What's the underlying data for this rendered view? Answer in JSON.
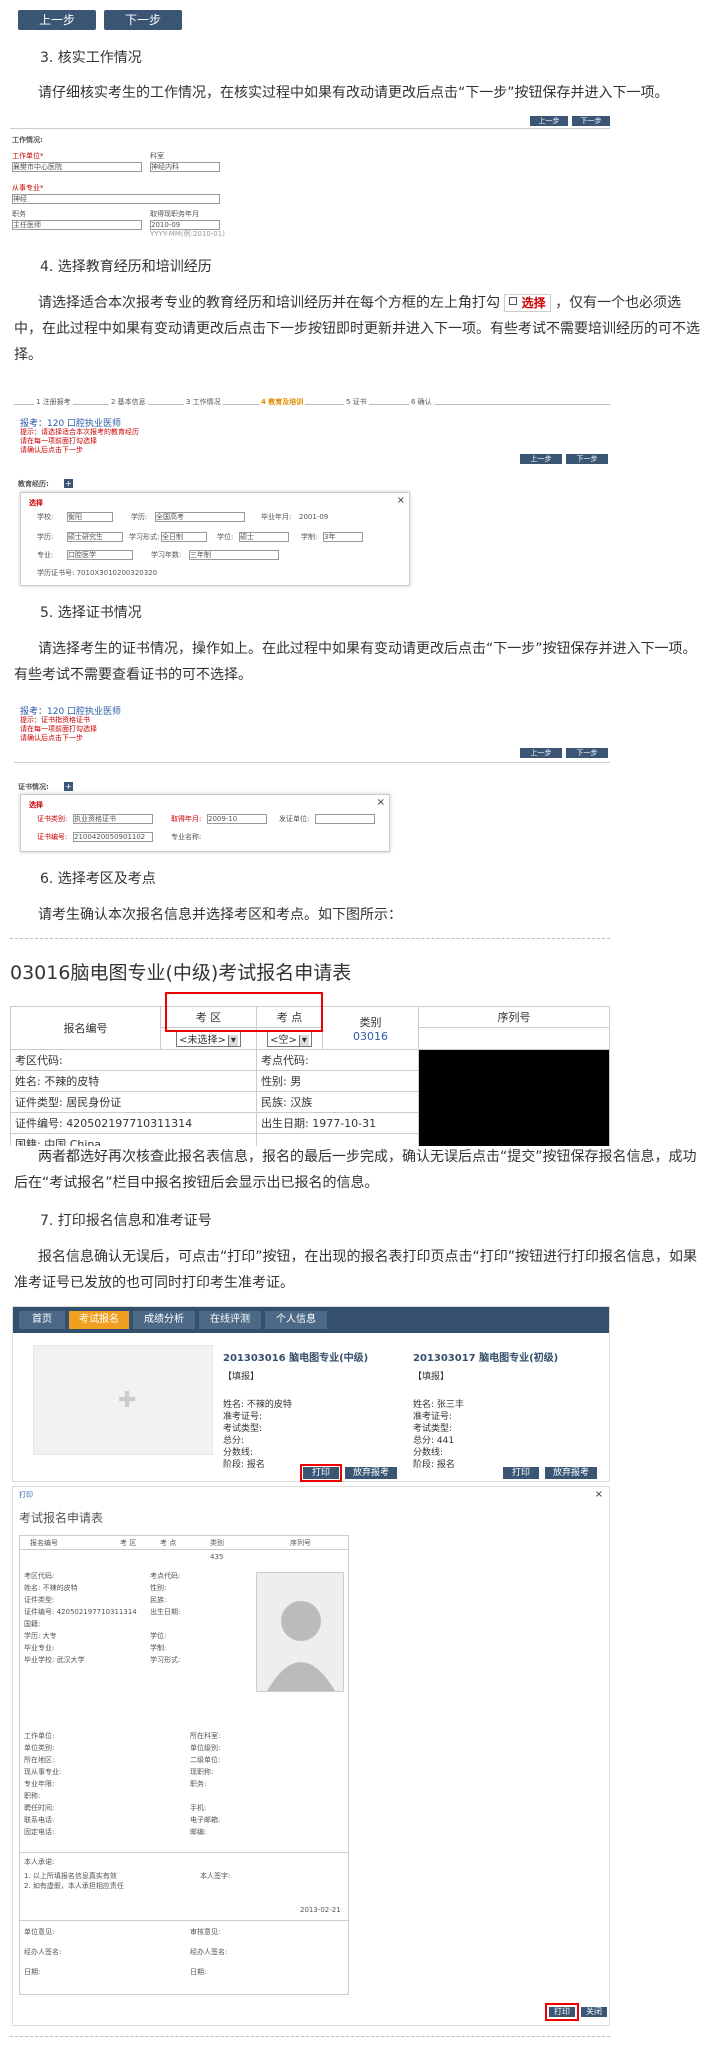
{
  "top_buttons": {
    "prev": "上一步",
    "next": "下一步"
  },
  "s3": {
    "heading": "3. 核实工作情况",
    "para": "请仔细核实考生的工作情况，在核实过程中如果有改动请更改后点击“下一步”按钮保存并进入下一项。",
    "shot": {
      "prev": "上一步",
      "next": "下一步",
      "section": "工作情况:",
      "f1": "工作单位*",
      "f2": "科室",
      "v1": "襄樊市中心医院",
      "v2": "神经内科",
      "f3": "从事专业*",
      "v3": "神经",
      "f4": "职务",
      "v4": "主任医师",
      "date_label": "取得现职务年月",
      "date_val": "2010-09",
      "date_hint": "YYYY-MM(例:2010-01)"
    }
  },
  "s4": {
    "heading": "4. 选择教育经历和培训经历",
    "para1": "请选择适合本次报考专业的教育经历和培训经历并在每个方框的左上角打勾",
    "select_word": "选择",
    "para2": "，仅有一个也必须选中，在此过程中如果有变动请更改后点击下一步按钮即时更新并进入下一项。有些考试不需要培训经历的可不选择。",
    "shot": {
      "steps": [
        "1 注册报考",
        "2 基本信息",
        "3 工作情况",
        "4 教育及培训",
        "5 证书",
        "6 确认"
      ],
      "apply": "报考：120 口腔执业医师",
      "note1": "提示：请选择适合本次报考的教育经历",
      "note2": "请在每一项前面打勾选择",
      "note3": "请确认后点击下一步",
      "prev": "上一步",
      "next": "下一步",
      "sub_title": "教育经历:",
      "select": "选择",
      "r1": [
        "学校:",
        "衡阳",
        "学历:",
        "全国高考",
        "毕业年月:",
        "2001-09"
      ],
      "r2": [
        "学历:",
        "硕士研究生",
        "学习形式:",
        "全日制",
        "学位:",
        "硕士",
        "学制:",
        "3年"
      ],
      "r3": [
        "专业:",
        "口腔医学",
        "学习年数:",
        "三年制"
      ],
      "cert": "学历证书号: 7010X3010200320320"
    }
  },
  "s5": {
    "heading": "5. 选择证书情况",
    "para": "请选择考生的证书情况，操作如上。在此过程中如果有变动请更改后点击“下一步”按钮保存并进入下一项。有些考试不需要查看证书的可不选择。",
    "shot": {
      "apply": "报考：120 口腔执业医师",
      "note1": "提示：证书指资格证书",
      "note2": "请在每一项前面打勾选择",
      "note3": "请确认后点击下一步",
      "prev": "上一步",
      "next": "下一步",
      "sub_title": "证书情况:",
      "select": "选择",
      "r1": [
        "证书类别:",
        "执业资格证书",
        "取得年月:",
        "2009-10",
        "发证单位:"
      ],
      "r2": [
        "证书编号:",
        "2100420050901102",
        "专业名称:"
      ]
    }
  },
  "s6": {
    "heading": "6. 选择考区及考点",
    "para": "请考生确认本次报名信息并选择考区和考点。如下图所示：",
    "form_title": "03016脑电图专业(中级)考试报名申请表",
    "col_regno": "报名编号",
    "col_area": "考 区",
    "col_site": "考 点",
    "col_type": "类别",
    "col_seq": "序列号",
    "area_sel": "<未选择>",
    "site_sel": "<空>",
    "type_val": "03016",
    "rows": [
      [
        "考区代码:",
        "",
        "考点代码:",
        ""
      ],
      [
        "姓名: 不辣的皮特",
        "",
        "性别: 男",
        ""
      ],
      [
        "证件类型: 居民身份证",
        "",
        "民族: 汉族",
        ""
      ],
      [
        "证件编号: 420502197710311314",
        "",
        "出生日期: 1977-10-31",
        ""
      ],
      [
        "国籍: 中国 China",
        "",
        "",
        ""
      ]
    ]
  },
  "s6b": {
    "para": "两者都选好再次核查此报名表信息，报名的最后一步完成，确认无误后点击“提交”按钮保存报名信息，成功后在“考试报名”栏目中报名按钮后会显示出已报名的信息。"
  },
  "s7": {
    "heading": "7. 打印报名信息和准考证号",
    "para": "报名信息确认无误后，可点击“打印”按钮，在出现的报名表打印页点击“打印”按钮进行打印报名信息，如果准考证号已发放的也可同时打印考生准考证。",
    "nav": [
      "首页",
      "考试报名",
      "成绩分析",
      "在线评测",
      "个人信息"
    ],
    "card1": {
      "title": "201303016 脑电图专业(中级)",
      "tag": "【填报】",
      "lines": [
        "姓名: 不辣的皮特",
        "准考证号:",
        "考试类型:",
        "总分:",
        "分数线:",
        "阶段: 报名"
      ],
      "print": "打印",
      "cancel": "放弃报考"
    },
    "card2": {
      "title": "201303017 脑电图专业(初级)",
      "tag": "【填报】",
      "lines": [
        "姓名: 张三丰",
        "准考证号:",
        "考试类型:",
        "总分: 441",
        "分数线:",
        "阶段: 报名"
      ],
      "print": "打印",
      "cancel": "放弃报考"
    },
    "print_dialog": {
      "title_bar": "打印",
      "form_title": "考试报名申请表",
      "hdr": [
        "报名编号",
        "考 区",
        "考 点",
        "类别",
        "序列号"
      ],
      "code": "435",
      "lines": [
        "考区代码:",
        "姓名: 不辣的皮特",
        "证件类型:",
        "证件编号: 420502197710311314",
        "国籍:",
        "学历: 大专",
        "毕业专业:",
        "毕业学校: 武汉大学",
        "工作单位:",
        "单位类别:",
        "所在地区:",
        "现从事专业:",
        "专业年限:",
        "职称:",
        "聘任时间:",
        "联系电话:",
        "固定电话:"
      ],
      "right_lines": [
        "考点代码:",
        "性别:",
        "民族:",
        "出生日期:",
        "学位:",
        "学制:",
        "学习形式:",
        "所在科室:",
        "单位级别:",
        "二级单位:",
        "现职称:",
        "职务:",
        "手机:",
        "电子邮箱:",
        "邮编:"
      ],
      "sign_rows": [
        "单位意见:",
        "审核意见:",
        "经办人签名:",
        "经办人签名:",
        "日期:",
        "日期:"
      ],
      "footnote1": "本人承诺:",
      "footnote2": "1. 以上所填报名信息真实有效",
      "footnote3": "2. 如有虚假，本人承担相应责任",
      "sign": "本人签字:",
      "date": "2013-02-21",
      "print_btn": "打印",
      "close_btn": "关闭"
    }
  }
}
